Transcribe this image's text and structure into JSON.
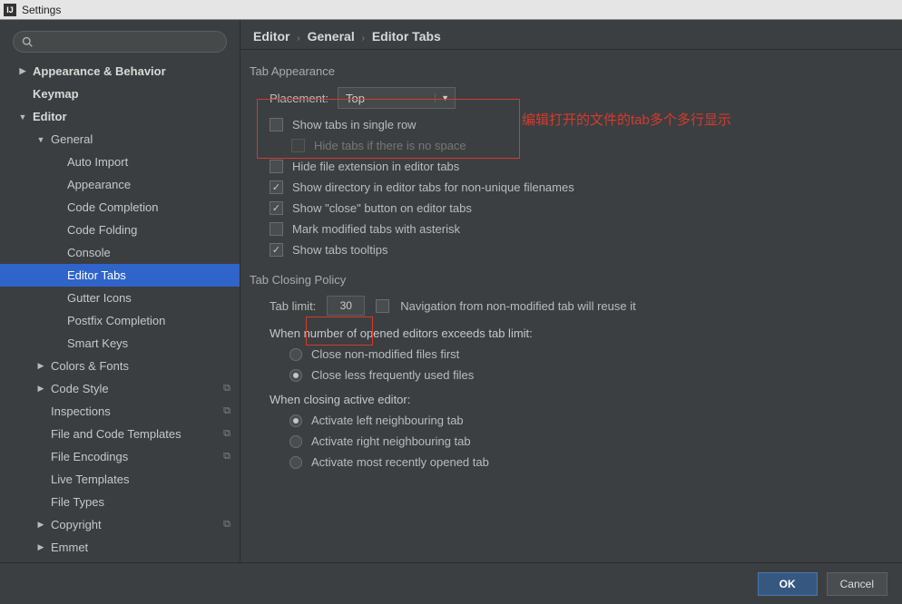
{
  "window": {
    "title": "Settings"
  },
  "search": {
    "placeholder": ""
  },
  "sidebar": {
    "items": [
      {
        "label": "Appearance & Behavior",
        "level": 0,
        "arrow": "right",
        "bold": true
      },
      {
        "label": "Keymap",
        "level": 0,
        "arrow": "",
        "bold": true
      },
      {
        "label": "Editor",
        "level": 0,
        "arrow": "down",
        "bold": true
      },
      {
        "label": "General",
        "level": 1,
        "arrow": "down",
        "bold": false
      },
      {
        "label": "Auto Import",
        "level": 2
      },
      {
        "label": "Appearance",
        "level": 2
      },
      {
        "label": "Code Completion",
        "level": 2
      },
      {
        "label": "Code Folding",
        "level": 2
      },
      {
        "label": "Console",
        "level": 2
      },
      {
        "label": "Editor Tabs",
        "level": 2,
        "selected": true
      },
      {
        "label": "Gutter Icons",
        "level": 2
      },
      {
        "label": "Postfix Completion",
        "level": 2
      },
      {
        "label": "Smart Keys",
        "level": 2
      },
      {
        "label": "Colors & Fonts",
        "level": 1,
        "arrow": "right"
      },
      {
        "label": "Code Style",
        "level": 1,
        "arrow": "right",
        "copy": true
      },
      {
        "label": "Inspections",
        "level": 1,
        "copy": true
      },
      {
        "label": "File and Code Templates",
        "level": 1,
        "copy": true
      },
      {
        "label": "File Encodings",
        "level": 1,
        "copy": true
      },
      {
        "label": "Live Templates",
        "level": 1
      },
      {
        "label": "File Types",
        "level": 1
      },
      {
        "label": "Copyright",
        "level": 1,
        "arrow": "right",
        "copy": true
      },
      {
        "label": "Emmet",
        "level": 1,
        "arrow": "right"
      }
    ]
  },
  "breadcrumb": {
    "p1": "Editor",
    "p2": "General",
    "p3": "Editor Tabs"
  },
  "sections": {
    "tab_appearance": {
      "title": "Tab Appearance",
      "placement_label": "Placement:",
      "placement_value": "Top",
      "show_single_row": "Show tabs in single row",
      "hide_if_no_space": "Hide tabs if there is no space",
      "hide_extension": "Hide file extension in editor tabs",
      "show_directory": "Show directory in editor tabs for non-unique filenames",
      "show_close": "Show \"close\" button on editor tabs",
      "mark_modified": "Mark modified tabs with asterisk",
      "show_tooltips": "Show tabs tooltips"
    },
    "tab_closing": {
      "title": "Tab Closing Policy",
      "tab_limit_label": "Tab limit:",
      "tab_limit_value": "30",
      "nav_reuse": "Navigation from non-modified tab will reuse it",
      "exceeds_label": "When number of opened editors exceeds tab limit:",
      "close_non_modified": "Close non-modified files first",
      "close_less_frequent": "Close less frequently used files",
      "closing_active_label": "When closing active editor:",
      "activate_left": "Activate left neighbouring tab",
      "activate_right": "Activate right neighbouring tab",
      "activate_recent": "Activate most recently opened tab"
    }
  },
  "annotation": {
    "text": "编辑打开的文件的tab多个多行显示"
  },
  "footer": {
    "ok": "OK",
    "cancel": "Cancel"
  }
}
